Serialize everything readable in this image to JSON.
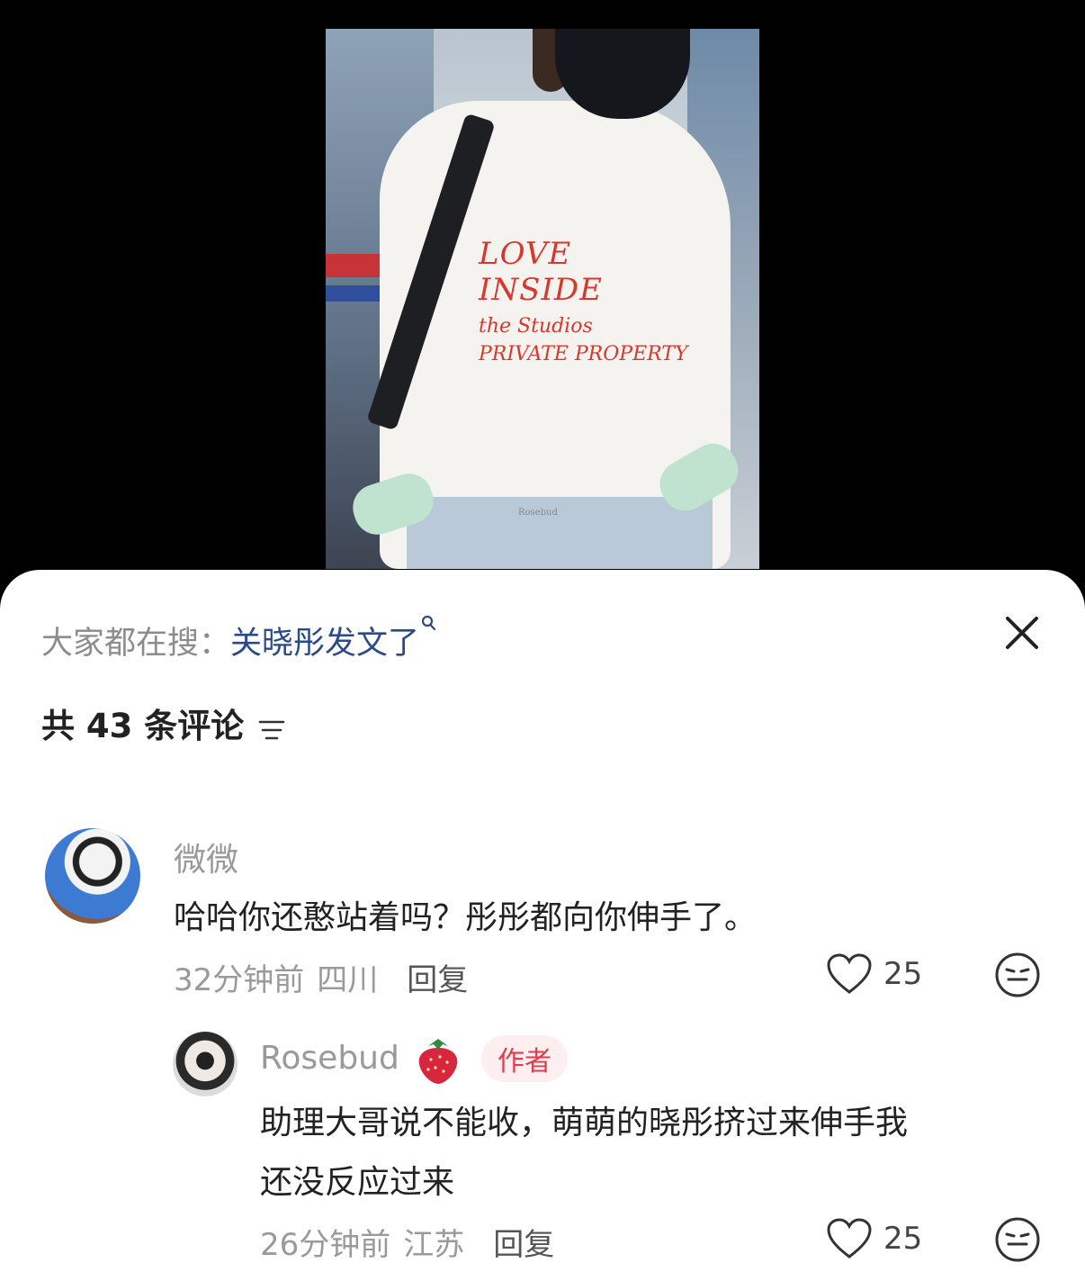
{
  "media": {
    "shirt_print": {
      "line1": "LOVE INSIDE",
      "line2": "the Studios",
      "line3": "PRIVATE PROPERTY"
    },
    "watermark": "Rosebud"
  },
  "sheet": {
    "search_prefix": "大家都在搜：",
    "search_term": "关晓彤发文了",
    "search_icon": "search-icon",
    "close_icon": "close-icon",
    "comment_count_label": "共 43 条评论",
    "filter_icon": "filter-icon"
  },
  "comments": [
    {
      "user": "微微",
      "text": "哈哈你还憨站着吗？彤彤都向你伸手了。",
      "time": "32分钟前",
      "location": "四川",
      "reply_label": "回复",
      "likes": "25"
    }
  ],
  "replies": [
    {
      "user": "Rosebud",
      "badge_emoji": "strawberry",
      "author_badge": "作者",
      "text_line1": "助理大哥说不能收，萌萌的晓彤挤过来伸手我",
      "text_line2": "还没反应过来",
      "time": "26分钟前",
      "location": "江苏",
      "reply_label": "回复",
      "likes": "25"
    }
  ],
  "colors": {
    "search_term": "#2b4a8a",
    "author_badge_bg": "#fdeef0",
    "author_badge_text": "#e23b4c",
    "shirt_print": "#d6382e"
  }
}
